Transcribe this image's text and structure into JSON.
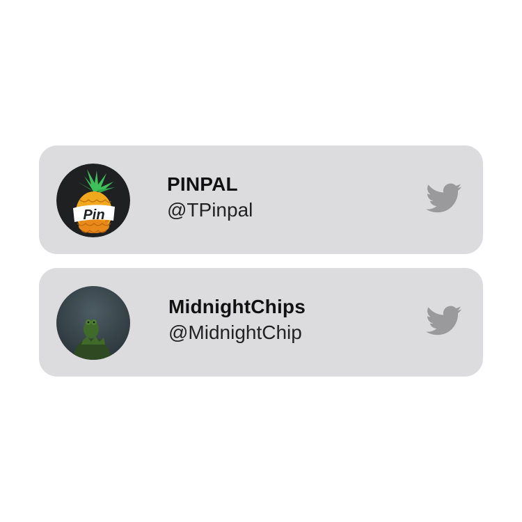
{
  "accounts": [
    {
      "display_name": "PINPAL",
      "handle": "@TPinpal",
      "avatar_icon": "pinpal-pineapple-logo",
      "avatar_text": "Pin",
      "network_icon": "twitter-bird-icon"
    },
    {
      "display_name": "MidnightChips",
      "handle": "@MidnightChip",
      "avatar_icon": "kermit-frog-photo",
      "network_icon": "twitter-bird-icon"
    }
  ],
  "colors": {
    "card_background": "#dcdcde",
    "icon_gray": "#9a9a9c",
    "text_primary": "#111111"
  }
}
